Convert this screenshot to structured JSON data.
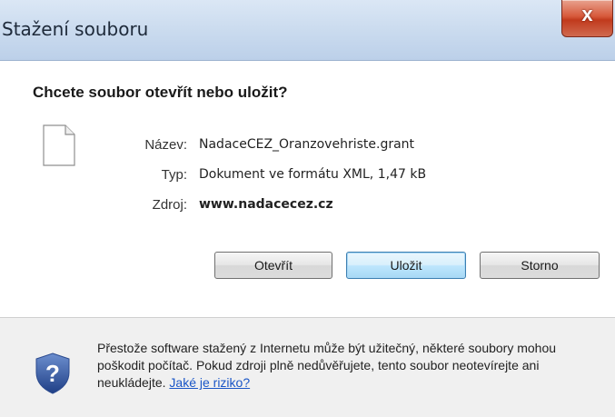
{
  "window": {
    "title": "Stažení souboru",
    "close_label": "x"
  },
  "prompt": {
    "heading": "Chcete soubor otevřít nebo uložit?"
  },
  "file": {
    "icon": "file-icon",
    "name_label": "Název:",
    "name_value": "NadaceCEZ_Oranzovehriste.grant",
    "type_label": "Typ:",
    "type_value": "Dokument ve formátu XML, 1,47 kB",
    "source_label": "Zdroj:",
    "source_value": "www.nadacecez.cz"
  },
  "buttons": {
    "open_label": "Otevřít",
    "save_label": "Uložit",
    "cancel_label": "Storno"
  },
  "footer": {
    "icon": "shield-question-icon",
    "warning_text": "Přestože software stažený z Internetu může být užitečný, některé soubory mohou poškodit počítač. Pokud zdroji plně nedůvěřujete, tento soubor neotevírejte ani neukládejte.",
    "risk_link": "Jaké je riziko?"
  },
  "colors": {
    "title_bar": "#c9daee",
    "close_button": "#c13a1d",
    "default_button": "#bee6fd",
    "footer_background": "#f0f0f0",
    "link": "#1a56c7"
  }
}
